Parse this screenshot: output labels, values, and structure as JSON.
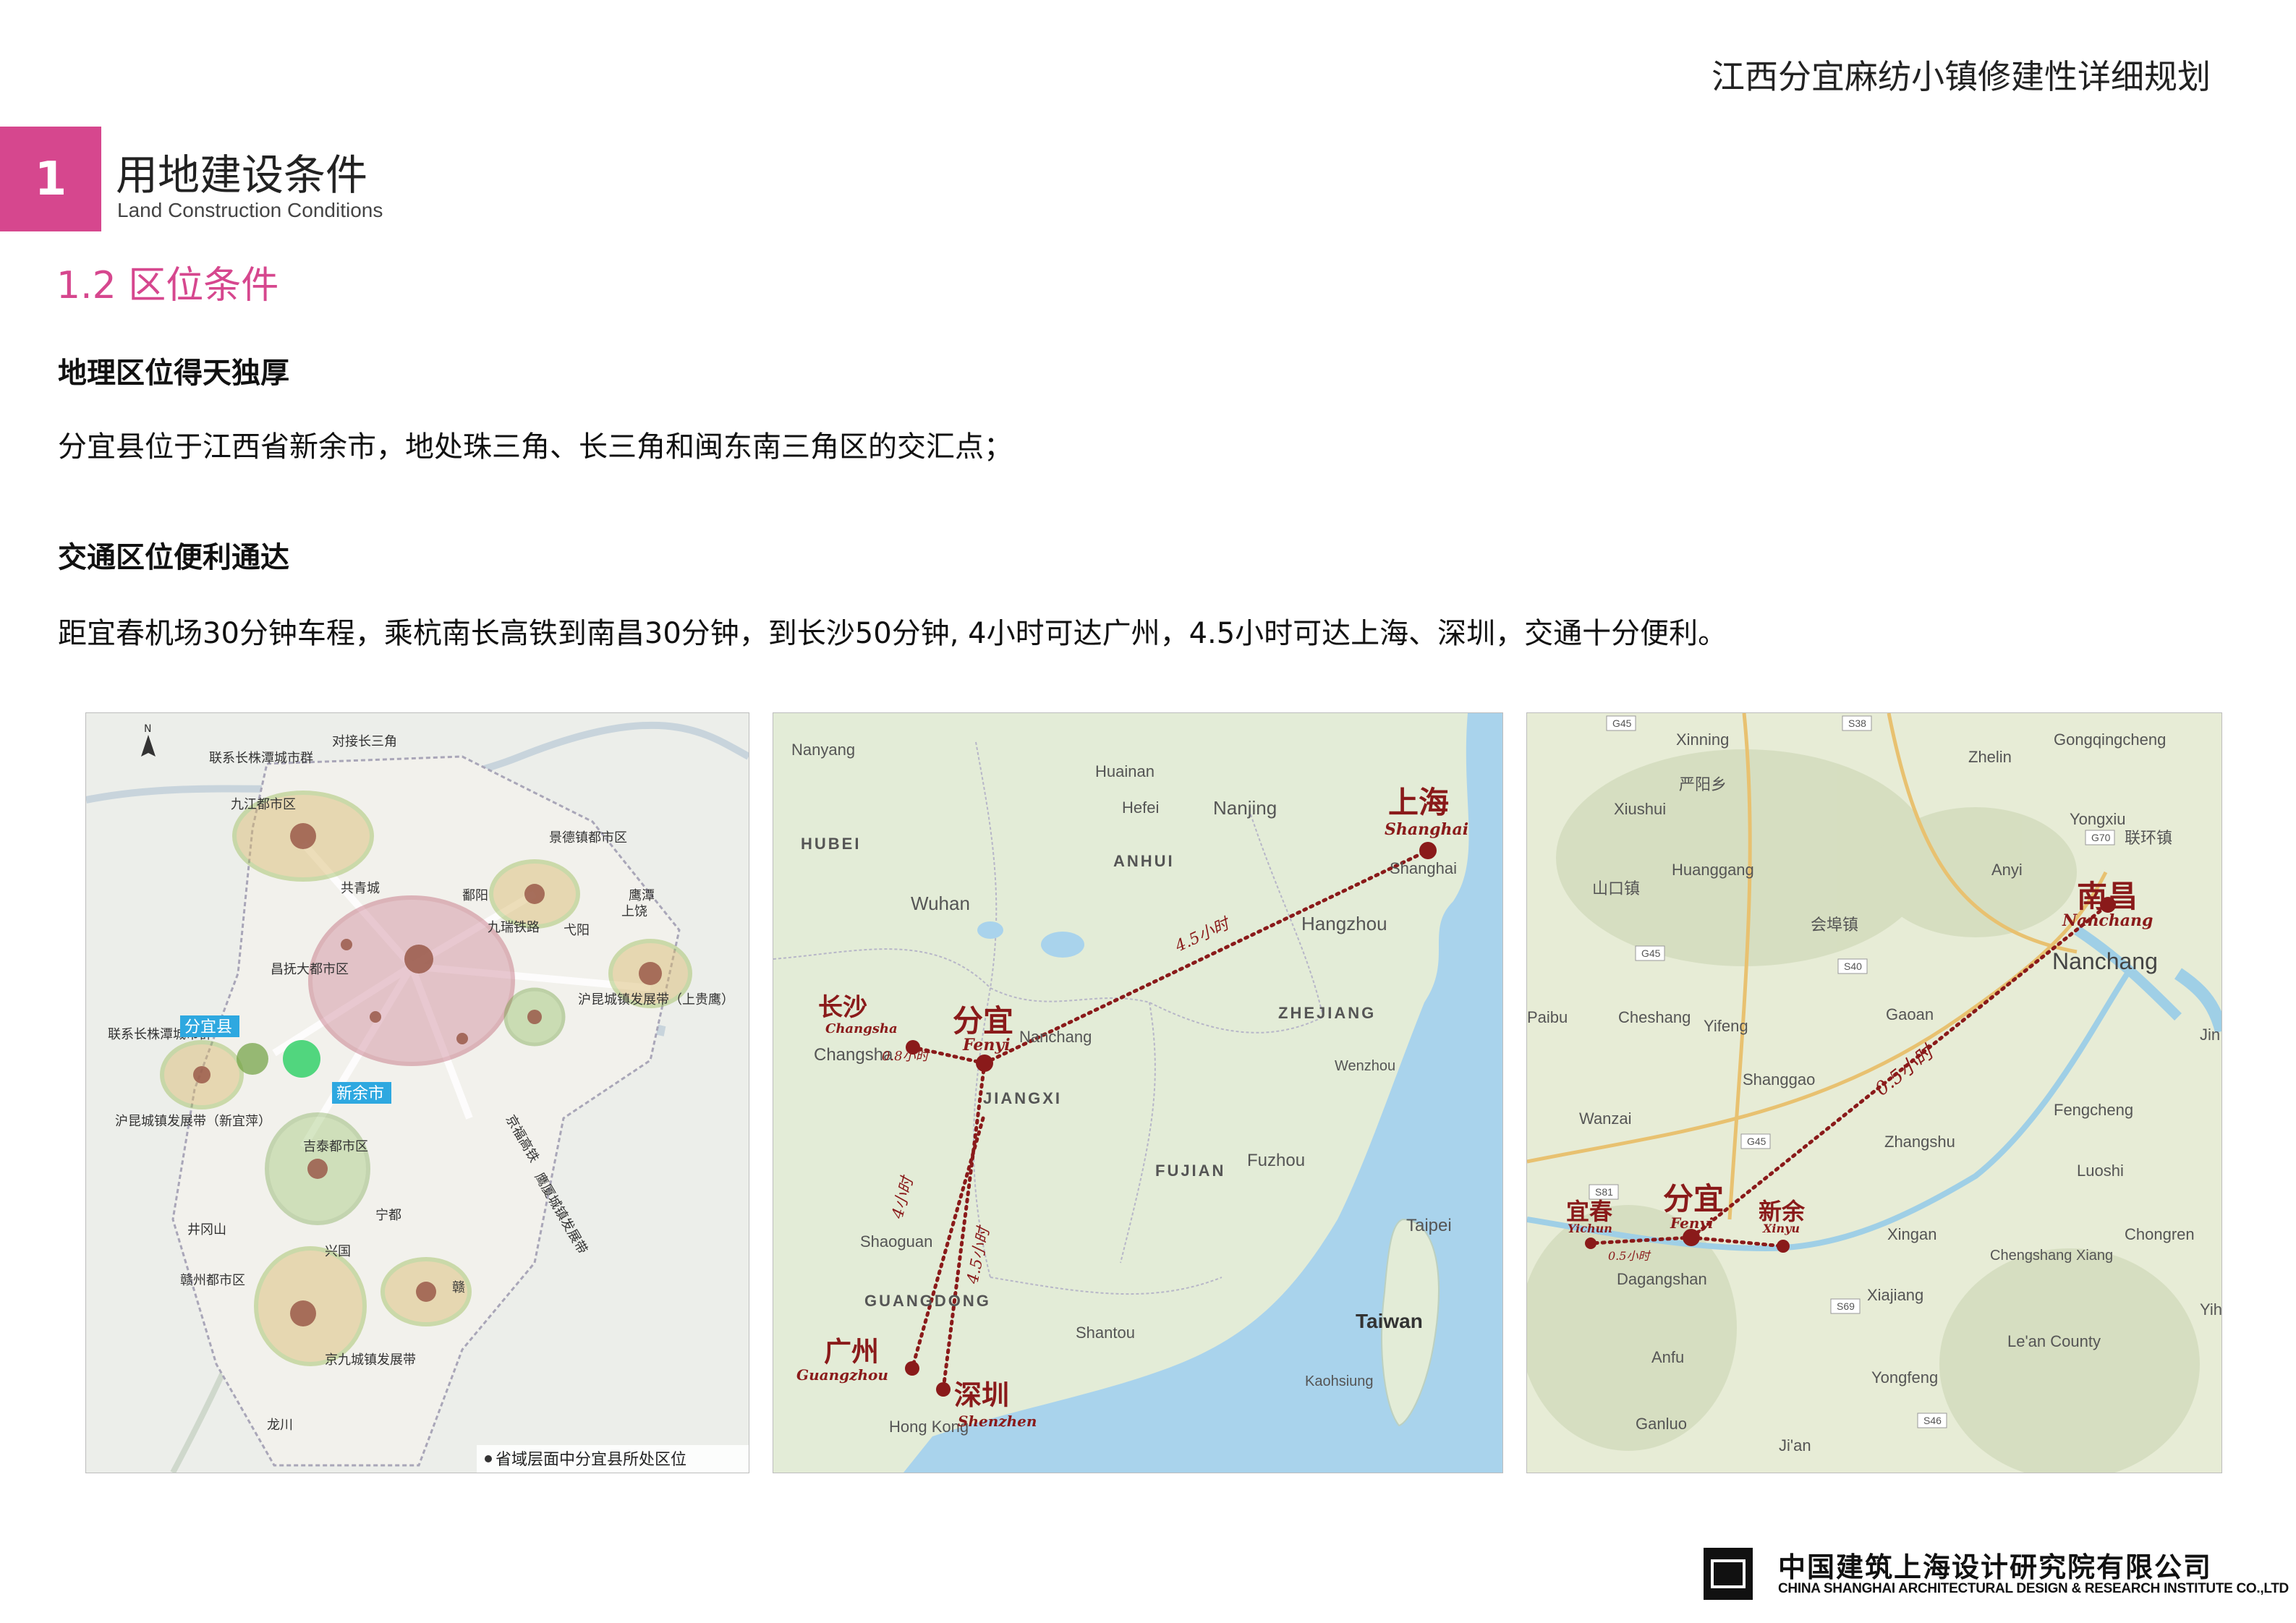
{
  "doc_title": "江西分宜麻纺小镇修建性详细规划",
  "section": {
    "number": "1",
    "title": "用地建设条件",
    "subtitle": "Land Construction Conditions"
  },
  "subsection": "1.2 区位条件",
  "geo": {
    "heading": "地理区位得天独厚",
    "text": "分宜县位于江西省新余市，地处珠三角、长三角和闽东南三角区的交汇点；"
  },
  "traffic": {
    "heading": "交通区位便利通达",
    "text": "距宜春机场30分钟车程，乘杭南长高铁到南昌30分钟，到长沙50分钟, 4小时可达广州，4.5小时可达上海、深圳，交通十分便利。"
  },
  "map1": {
    "labels": [
      "九江都市区",
      "景德镇都市区",
      "鹰潭",
      "昌抚大都市区",
      "共青城",
      "鄱阳",
      "九瑞铁路",
      "弋阳",
      "上饶",
      "沪昆城镇发展带（上贵鹰）",
      "分宜县",
      "新余市",
      "联系长株潭城市群",
      "沪昆城镇发展带（新宜萍）",
      "吉泰都市区",
      "井冈山",
      "宁都",
      "兴国",
      "赣州都市区",
      "京九城镇发展带",
      "龙川",
      "对接长三角",
      "联系长株潭城市群",
      "京福高铁",
      "鹰厦城镇发展带",
      "赣"
    ],
    "caption": "省域层面中分宜县所处区位",
    "colors": {
      "pink": "#d08a9b",
      "green": "#8fbf5f",
      "gold": "#d9b86a",
      "node": "#9a5a4a"
    }
  },
  "map2": {
    "places": [
      "Nanyang",
      "HUBEI",
      "Huainan",
      "Hefei",
      "Nanjing",
      "ANHUI",
      "Wuhan",
      "Shanghai",
      "Hangzhou",
      "Changsha",
      "Nanchang",
      "JIANGXI",
      "ZHEJIANG",
      "Wenzhou",
      "FUJIAN",
      "Fuzhou",
      "Shaoguan",
      "GUANGDONG",
      "Shantou",
      "Taipei",
      "Taiwan",
      "Kaohsiung",
      "Hong Kong"
    ],
    "cities": [
      {
        "cn": "上海",
        "en": "Shanghai"
      },
      {
        "cn": "长沙",
        "en": "Changsha"
      },
      {
        "cn": "分宜",
        "en": "Fenyi"
      },
      {
        "cn": "广州",
        "en": "Guangzhou"
      },
      {
        "cn": "深圳",
        "en": "Shenzhen"
      }
    ],
    "times": [
      "4.5小时",
      "0.8小时",
      "4小时",
      "4.5小时"
    ],
    "colors": {
      "land": "#e3ecd7",
      "sea": "#a9d3ec",
      "route": "#8a1a1a"
    }
  },
  "map3": {
    "places": [
      "Xinning",
      "Zhelin",
      "Gongqingcheng",
      "严阳乡",
      "Xiushui",
      "Yongxiu",
      "联环镇",
      "Huanggang",
      "Anyi",
      "山口镇",
      "会埠镇",
      "Nanchang",
      "Paibu",
      "Cheshang",
      "Yifeng",
      "Gaoan",
      "Shanggao",
      "Fengcheng",
      "Wanzai",
      "Zhangshu",
      "Luoshi",
      "Xingan",
      "Chengshang Xiang",
      "Chongren",
      "Dagangshan",
      "Xiajiang",
      "Anfu",
      "Le'an County",
      "Yongfeng",
      "Ganluo",
      "Ji'an",
      "Yih",
      "Jin"
    ],
    "roads": [
      "G45",
      "S38",
      "G70",
      "G45",
      "S40",
      "G45",
      "S81",
      "S69",
      "S46"
    ],
    "cities": [
      {
        "cn": "南昌",
        "en": "Nanchang"
      },
      {
        "cn": "宜春",
        "en": "Yichun"
      },
      {
        "cn": "分宜",
        "en": "Fenyi"
      },
      {
        "cn": "新余",
        "en": "Xinyu"
      }
    ],
    "times": [
      "0.5小时",
      "0.5小时"
    ],
    "colors": {
      "land": "#e7ecd6",
      "route": "#8a1a1a"
    }
  },
  "footer": {
    "cn": "中国建筑上海设计研究院有限公司",
    "en": "CHINA SHANGHAI ARCHITECTURAL DESIGN & RESEARCH INSTITUTE CO.,LTD"
  }
}
